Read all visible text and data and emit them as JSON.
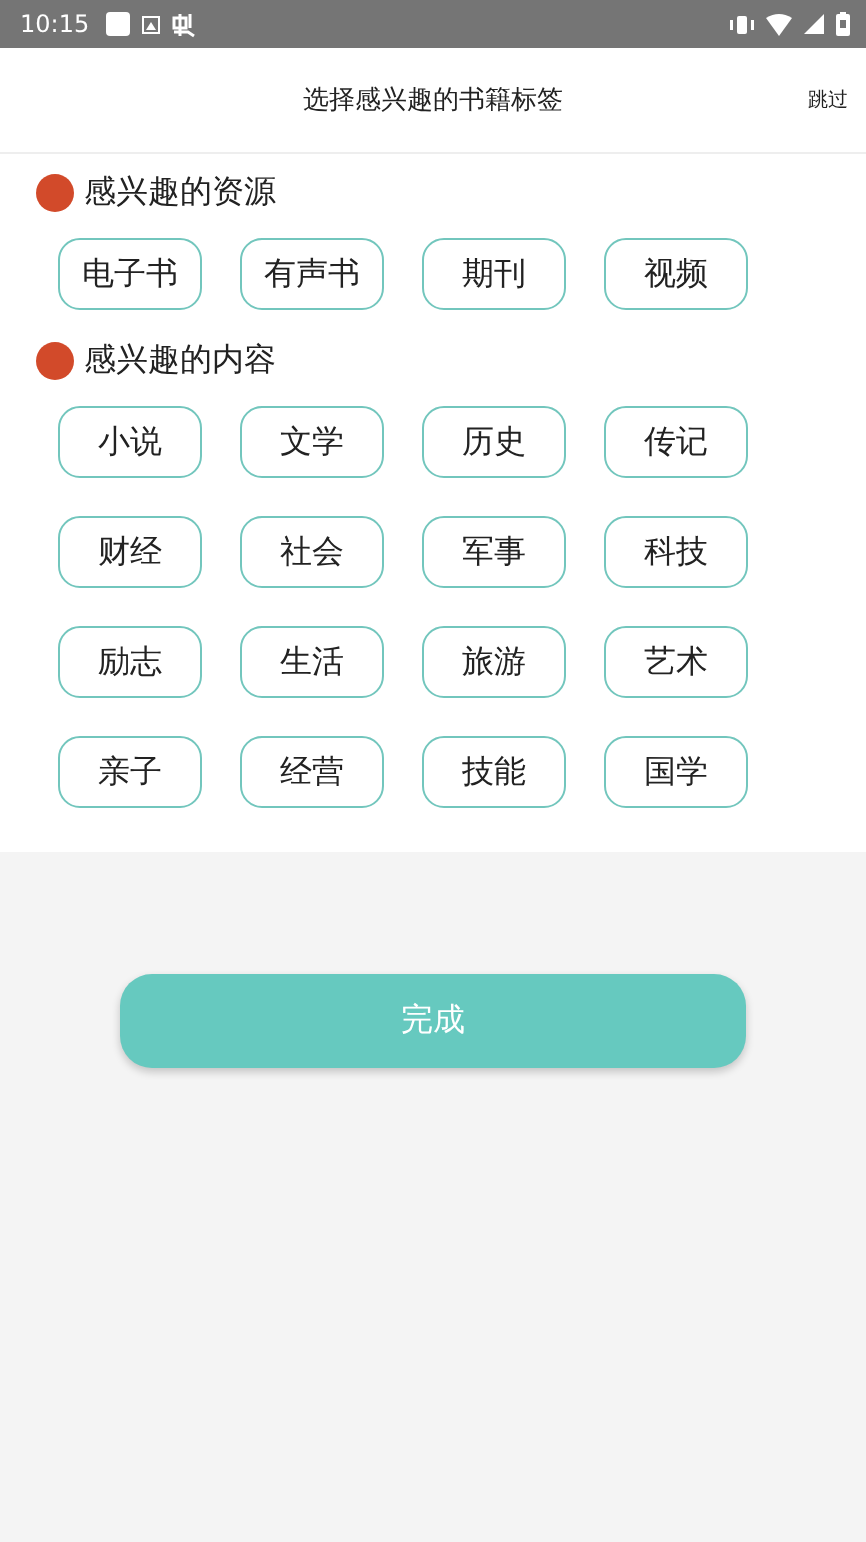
{
  "status_bar": {
    "time": "10:15"
  },
  "header": {
    "title": "选择感兴趣的书籍标签",
    "skip": "跳过"
  },
  "sections": [
    {
      "title": "感兴趣的资源",
      "color": "#d24a2a",
      "tags": [
        {
          "label": "电子书",
          "selected": false
        },
        {
          "label": "有声书",
          "selected": false
        },
        {
          "label": "期刊",
          "selected": false
        },
        {
          "label": "视频",
          "selected": false
        }
      ]
    },
    {
      "title": "感兴趣的内容",
      "color": "#d24a2a",
      "tags": [
        {
          "label": "小说",
          "selected": false
        },
        {
          "label": "文学",
          "selected": false
        },
        {
          "label": "历史",
          "selected": false
        },
        {
          "label": "传记",
          "selected": false
        },
        {
          "label": "财经",
          "selected": false
        },
        {
          "label": "社会",
          "selected": false
        },
        {
          "label": "军事",
          "selected": false
        },
        {
          "label": "科技",
          "selected": false
        },
        {
          "label": "励志",
          "selected": false
        },
        {
          "label": "生活",
          "selected": false
        },
        {
          "label": "旅游",
          "selected": false
        },
        {
          "label": "艺术",
          "selected": false
        },
        {
          "label": "亲子",
          "selected": false
        },
        {
          "label": "经营",
          "selected": false
        },
        {
          "label": "技能",
          "selected": false
        },
        {
          "label": "国学",
          "selected": false
        }
      ]
    }
  ],
  "done_button": "完成"
}
